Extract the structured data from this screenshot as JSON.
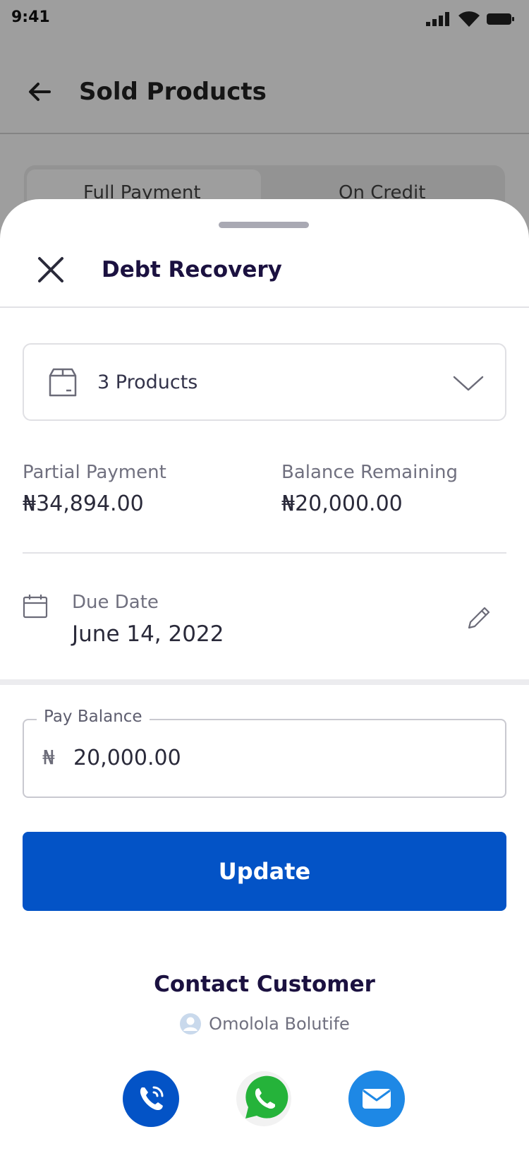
{
  "status_bar": {
    "time": "9:41"
  },
  "background_screen": {
    "title": "Sold Products",
    "tabs": [
      {
        "label": "Full Payment",
        "active": true
      },
      {
        "label": "On Credit",
        "active": false
      }
    ]
  },
  "sheet": {
    "title": "Debt Recovery",
    "products_select": {
      "label": "3 Products"
    },
    "partial_payment": {
      "label": "Partial Payment",
      "value": "₦34,894.00"
    },
    "balance_remaining": {
      "label": "Balance Remaining",
      "value": "₦20,000.00"
    },
    "due_date": {
      "label": "Due Date",
      "value": "June 14, 2022"
    },
    "pay_balance": {
      "legend": "Pay Balance",
      "currency": "₦",
      "value": "20,000.00"
    },
    "update_button": {
      "label": "Update"
    },
    "contact": {
      "title": "Contact Customer",
      "customer_name": "Omolola Bolutife",
      "actions": [
        "call",
        "whatsapp",
        "email"
      ]
    }
  },
  "colors": {
    "primary": "#0353c6",
    "title_text": "#1b1140",
    "whatsapp": "#25b33a",
    "email": "#1e88e5"
  },
  "icons": [
    "back-arrow-icon",
    "close-icon",
    "box-icon",
    "chevron-down-icon",
    "calendar-icon",
    "pencil-icon",
    "person-icon",
    "phone-icon",
    "whatsapp-icon",
    "mail-icon"
  ]
}
